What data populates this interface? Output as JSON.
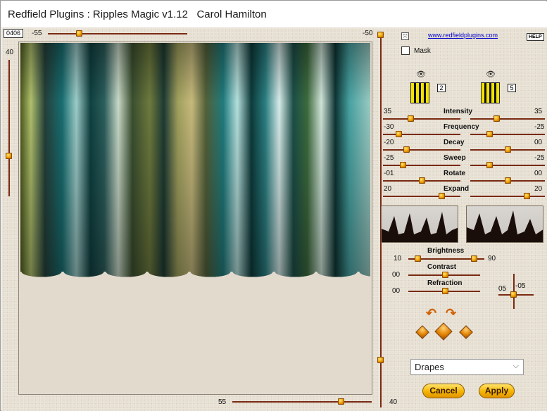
{
  "window": {
    "title": "Redfield Plugins : Ripples Magic v1.12   Carol Hamilton"
  },
  "preview": {
    "counter": "0406",
    "top_slider": {
      "value": "-55",
      "fraction": 0.22
    },
    "left_slider": {
      "value": "40",
      "fraction": 0.7
    },
    "right_slider_top": {
      "value": "-50",
      "fraction": 0.0
    },
    "right_slider_bottom": {
      "value": "40",
      "fraction": 0.82
    },
    "bottom_slider": {
      "value": "55",
      "fraction": 0.78
    }
  },
  "header_links": {
    "website": "www.redfieldplugins.com",
    "help": "HELP",
    "mask_label": "Mask"
  },
  "pattern_left": {
    "number": "2"
  },
  "pattern_right": {
    "number": "5"
  },
  "params": [
    {
      "name": "Intensity",
      "left_value": "35",
      "right_value": "35",
      "left_fraction": 0.35,
      "right_fraction": 0.35
    },
    {
      "name": "Frequency",
      "left_value": "-30",
      "right_value": "-25",
      "left_fraction": 0.2,
      "right_fraction": 0.25
    },
    {
      "name": "Decay",
      "left_value": "-20",
      "right_value": "00",
      "left_fraction": 0.3,
      "right_fraction": 0.5
    },
    {
      "name": "Sweep",
      "left_value": "-25",
      "right_value": "-25",
      "left_fraction": 0.25,
      "right_fraction": 0.25
    },
    {
      "name": "Rotate",
      "left_value": "-01",
      "right_value": "00",
      "left_fraction": 0.5,
      "right_fraction": 0.5
    },
    {
      "name": "Expand",
      "left_value": "20",
      "right_value": "20",
      "left_fraction": 0.75,
      "right_fraction": 0.75
    }
  ],
  "brightness": {
    "label": "Brightness",
    "min_value": "10",
    "max_value": "90"
  },
  "contrast": {
    "label": "Contrast",
    "value": "00",
    "fraction": 0.5
  },
  "refraction": {
    "label": "Refraction",
    "value": "00",
    "fraction": 0.5
  },
  "offset": {
    "x_value": "05",
    "y_value": "-05"
  },
  "style_select": {
    "selected": "Drapes"
  },
  "buttons": {
    "cancel": "Cancel",
    "apply": "Apply"
  },
  "colors": {
    "track": "#7a2a12",
    "thumb": "#f0a000",
    "panel": "#e6dfd2",
    "link": "#0000cc"
  }
}
